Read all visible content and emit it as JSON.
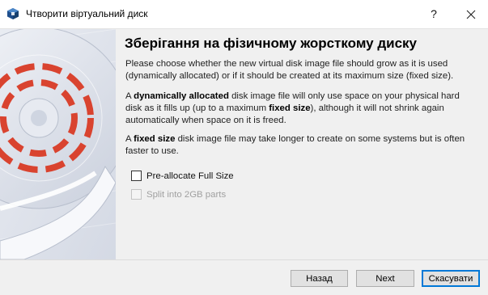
{
  "window": {
    "title": "Чтворити віртуальний диск",
    "help_label": "?"
  },
  "page": {
    "heading": "Зберігання на фізичному жорсткому диску",
    "para1": "Please choose whether the new virtual disk image file should grow as it is used (dynamically allocated) or if it should be created at its maximum size (fixed size).",
    "para2": {
      "prefix": "A ",
      "bold1": "dynamically allocated",
      "middle": " disk image file will only use space on your physical hard disk as it fills up (up to a maximum ",
      "bold2": "fixed size",
      "suffix": "), although it will not shrink again automatically when space on it is freed."
    },
    "para3": {
      "prefix": "A ",
      "bold": "fixed size",
      "suffix": " disk image file may take longer to create on some systems but is often faster to use."
    }
  },
  "options": {
    "preallocate": {
      "label": "Pre-allocate Full Size",
      "checked": false,
      "enabled": true
    },
    "split": {
      "label": "Split into 2GB parts",
      "checked": false,
      "enabled": false
    }
  },
  "buttons": {
    "back": "Назад",
    "next": "Next",
    "cancel": "Скасувати"
  },
  "colors": {
    "accent_red": "#d9432f",
    "focus_blue": "#0078d7",
    "art_background": "#dfe3ec"
  },
  "icons": {
    "app": "virtualbox-icon",
    "close": "close-icon",
    "art": "hard-disk-illustration"
  }
}
